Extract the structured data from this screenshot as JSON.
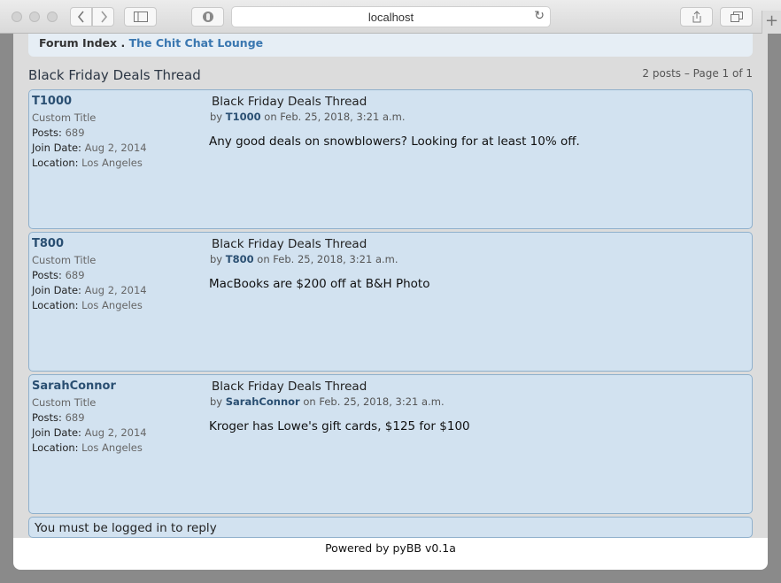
{
  "browser": {
    "url": "localhost",
    "new_tab": "+"
  },
  "breadcrumb": {
    "index": "Forum Index",
    "separator": ".",
    "current": "The Chit Chat Lounge"
  },
  "thread": {
    "title": "Black Friday Deals Thread",
    "page_info": "2 posts – Page 1 of 1"
  },
  "labels": {
    "posts": "Posts:",
    "join_date": "Join Date:",
    "location": "Location:",
    "by": "by",
    "on": "on"
  },
  "posts": [
    {
      "username": "T1000",
      "custom_title": "Custom Title",
      "posts": "689",
      "join_date": "Aug 2, 2014",
      "location": "Los Angeles",
      "title": "Black Friday Deals Thread",
      "author": "T1000",
      "date": "Feb. 25, 2018, 3:21 a.m.",
      "body": "Any good deals on snowblowers? Looking for at least 10% off."
    },
    {
      "username": "T800",
      "custom_title": "Custom Title",
      "posts": "689",
      "join_date": "Aug 2, 2014",
      "location": "Los Angeles",
      "title": "Black Friday Deals Thread",
      "author": "T800",
      "date": "Feb. 25, 2018, 3:21 a.m.",
      "body": "MacBooks are $200 off at B&H Photo"
    },
    {
      "username": "SarahConnor",
      "custom_title": "Custom Title",
      "posts": "689",
      "join_date": "Aug 2, 2014",
      "location": "Los Angeles",
      "title": "Black Friday Deals Thread",
      "author": "SarahConnor",
      "date": "Feb. 25, 2018, 3:21 a.m.",
      "body": "Kroger has Lowe's gift cards, $125 for $100"
    }
  ],
  "reply_notice": "You must be logged in to reply",
  "footer": "Powered by pyBB v0.1a"
}
